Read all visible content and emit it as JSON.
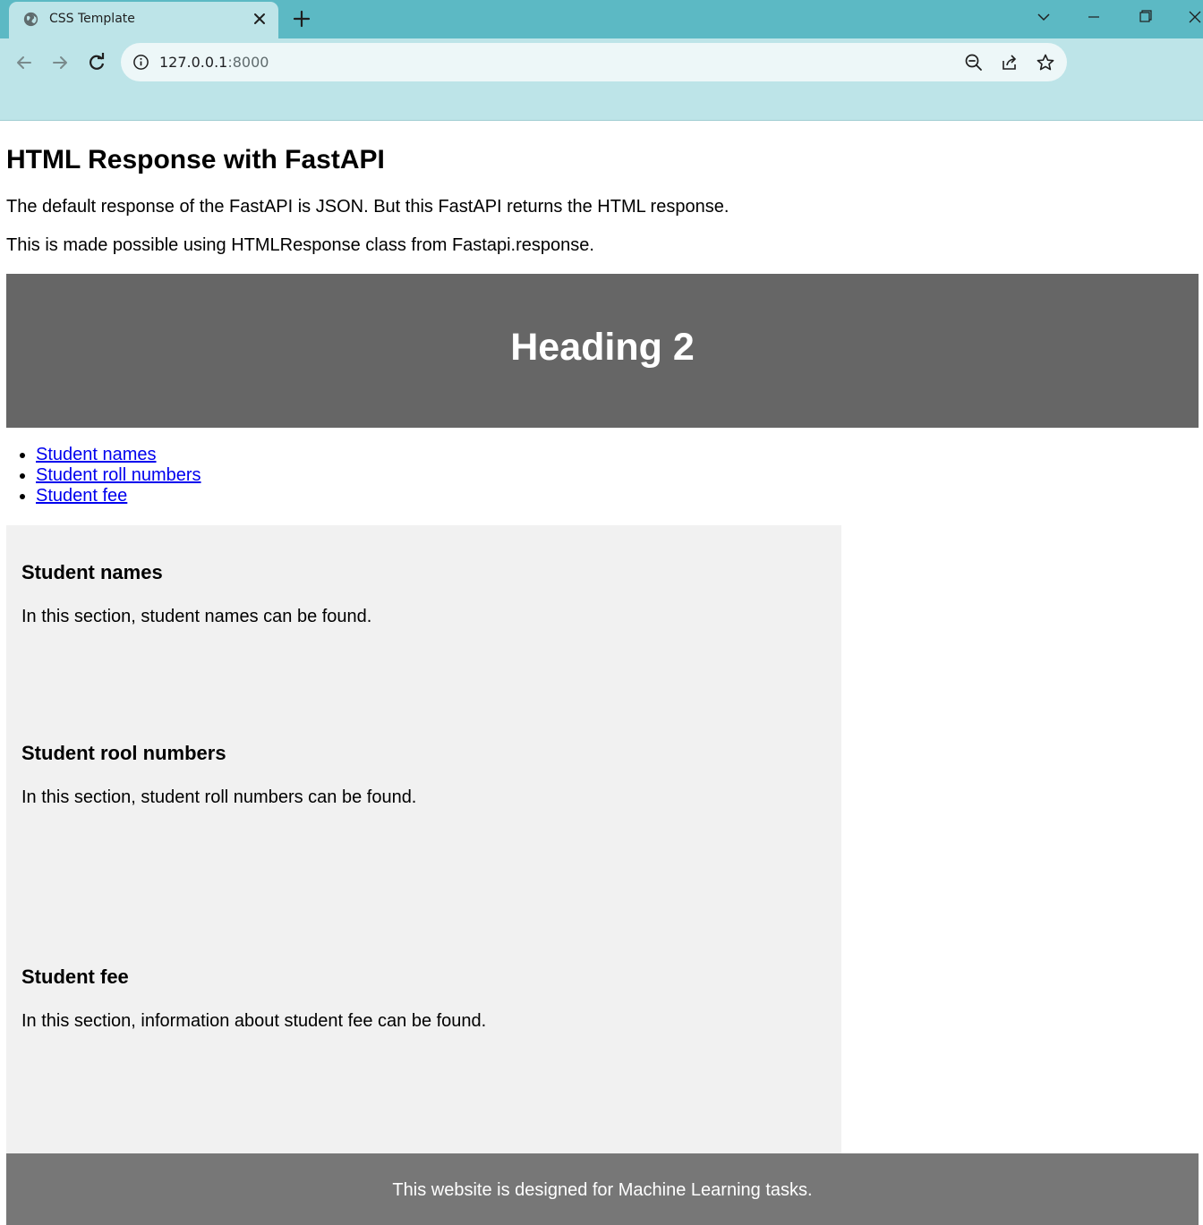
{
  "browser": {
    "tab_title": "CSS Template",
    "url_host": "127.0.0.1",
    "url_port": ":8000",
    "tab_favicon": "globe-icon",
    "icons": [
      "close-icon",
      "plus-icon",
      "chevron-down-icon",
      "minimize-icon",
      "restore-icon",
      "window-close-icon",
      "back-arrow-icon",
      "forward-arrow-icon",
      "reload-icon",
      "info-icon",
      "zoom-out-icon",
      "share-icon",
      "star-icon"
    ],
    "colors": {
      "tabbar": "#5cb9c4",
      "toolbar": "#bde4e8",
      "omnibox": "#edf7f8"
    }
  },
  "page": {
    "title": "HTML Response with FastAPI",
    "intro_1": "The default response of the FastAPI is JSON. But this FastAPI returns the HTML response.",
    "intro_2": "This is made possible using HTMLResponse class from Fastapi.response.",
    "hero_heading": "Heading 2",
    "nav_links": [
      "Student names",
      "Student roll numbers",
      "Student fee"
    ],
    "sections": [
      {
        "title": "Student names",
        "text": "In this section, student names can be found."
      },
      {
        "title": "Student rool numbers",
        "text": "In this section, student roll numbers can be found."
      },
      {
        "title": "Student fee",
        "text": "In this section, information about student fee can be found."
      }
    ],
    "footer": "This website is designed for Machine Learning tasks.",
    "colors": {
      "hero": "#666666",
      "sections_bg": "#f1f1f1",
      "footer": "#777777",
      "link": "#0000ee"
    }
  }
}
